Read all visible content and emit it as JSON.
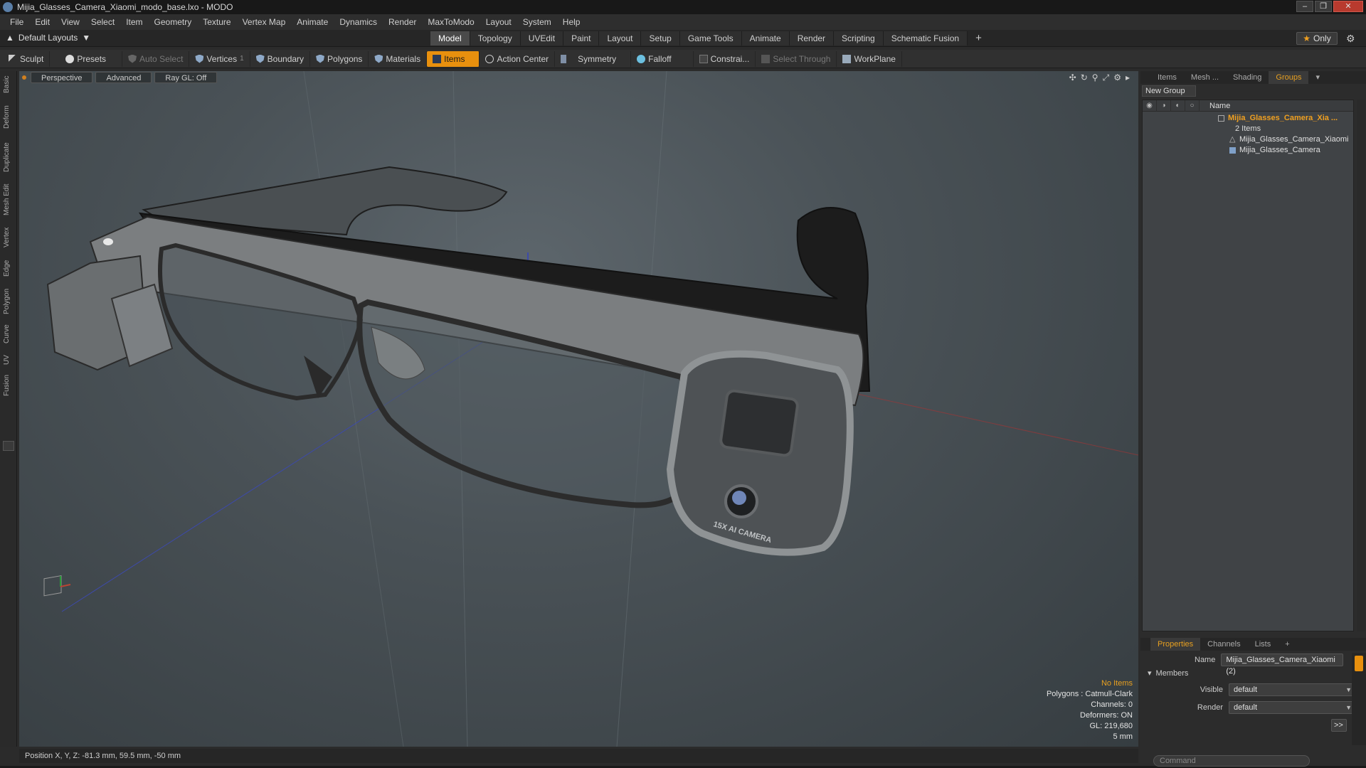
{
  "window": {
    "title": "Mijia_Glasses_Camera_Xiaomi_modo_base.lxo - MODO"
  },
  "menu": [
    "File",
    "Edit",
    "View",
    "Select",
    "Item",
    "Geometry",
    "Texture",
    "Vertex Map",
    "Animate",
    "Dynamics",
    "Render",
    "MaxToModo",
    "Layout",
    "System",
    "Help"
  ],
  "layout": {
    "selector": "Default Layouts",
    "tabs": [
      "Model",
      "Topology",
      "UVEdit",
      "Paint",
      "Layout",
      "Setup",
      "Game Tools",
      "Animate",
      "Render",
      "Scripting",
      "Schematic Fusion"
    ],
    "active_tab": "Model",
    "only_label": "Only"
  },
  "toolbar": {
    "sculpt": "Sculpt",
    "presets": "Presets",
    "auto_select": "Auto Select",
    "vertices": "Vertices",
    "vertices_count": "1",
    "boundary": "Boundary",
    "polygons": "Polygons",
    "materials": "Materials",
    "items": "Items",
    "action_center": "Action Center",
    "symmetry": "Symmetry",
    "falloff": "Falloff",
    "constraints": "Constrai...",
    "select_through": "Select Through",
    "workplane": "WorkPlane"
  },
  "left_tabs": [
    "Basic",
    "Deform",
    "Duplicate",
    "Mesh Edit",
    "Vertex",
    "Edge",
    "Polygon",
    "Curve",
    "UV",
    "Fusion"
  ],
  "viewport": {
    "view_mode": "Perspective",
    "advanced": "Advanced",
    "raygl": "Ray GL: Off",
    "camera_text": "15X AI CAMERA",
    "info": {
      "selection": "No Items",
      "polygons": "Polygons : Catmull-Clark",
      "channels": "Channels: 0",
      "deformers": "Deformers: ON",
      "gl": "GL: 219,680",
      "scale": "5 mm"
    }
  },
  "status": {
    "position": "Position X, Y, Z:  -81.3 mm, 59.5 mm, -50 mm"
  },
  "panel": {
    "tabs": [
      "Items",
      "Mesh ...",
      "Shading",
      "Groups"
    ],
    "active_tab": "Groups",
    "new_group": "New Group",
    "name_col": "Name",
    "group_name": "Mijia_Glasses_Camera_Xia ...",
    "group_count": "2 Items",
    "members": [
      "Mijia_Glasses_Camera_Xiaomi",
      "Mijia_Glasses_Camera"
    ]
  },
  "properties": {
    "tabs": [
      "Properties",
      "Channels",
      "Lists"
    ],
    "active_tab": "Properties",
    "name_label": "Name",
    "name_value": "Mijia_Glasses_Camera_Xiaomi (2)",
    "section": "Members",
    "visible_label": "Visible",
    "visible_value": "default",
    "render_label": "Render",
    "render_value": "default",
    "more": ">>",
    "command_placeholder": "Command"
  },
  "colors": {
    "accent": "#e8900e",
    "group_highlight": "#f0a020"
  }
}
